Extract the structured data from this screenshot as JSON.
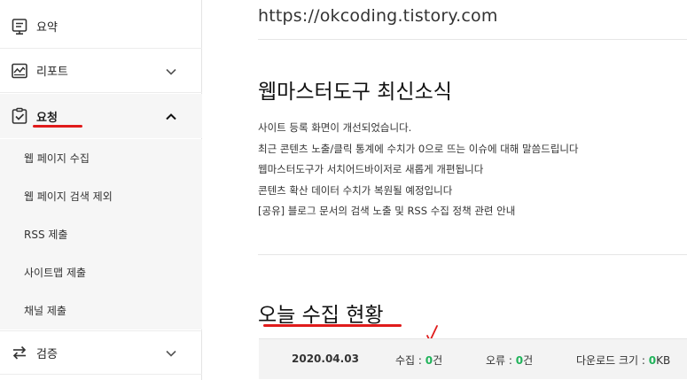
{
  "sidebar": {
    "items": [
      {
        "label": "요약",
        "icon": "summary-icon"
      },
      {
        "label": "리포트",
        "icon": "report-chart-icon"
      },
      {
        "label": "요청",
        "icon": "request-check-icon"
      },
      {
        "label": "검증",
        "icon": "verify-swap-icon"
      }
    ],
    "subitems": [
      {
        "label": "웹 페이지 수집"
      },
      {
        "label": "웹 페이지 검색 제외"
      },
      {
        "label": "RSS 제출"
      },
      {
        "label": "사이트맵 제출"
      },
      {
        "label": "채널 제출"
      }
    ]
  },
  "main": {
    "site_url": "https://okcoding.tistory.com",
    "news_title": "웹마스터도구 최신소식",
    "news": [
      "사이트 등록 화면이 개선되었습니다.",
      "최근 콘텐츠 노출/클릭 통계에 수치가 0으로 뜨는 이슈에 대해 말씀드립니다",
      "웹마스터도구가 서치어드바이저로 새롭게 개편됩니다",
      "콘텐츠 확산 데이터 수치가 복원될 예정입니다",
      "[공유] 블로그 문서의 검색 노출 및 RSS 수집 정책 관련 안내"
    ],
    "stats_title": "오늘 수집 현황",
    "stats": {
      "date": "2020.04.03",
      "collect_label": "수집 : ",
      "collect_value": "0",
      "collect_unit": "건",
      "error_label": "오류 : ",
      "error_value": "0",
      "error_unit": "건",
      "download_label": "다운로드 크기 : ",
      "download_value": "0",
      "download_unit": "KB"
    }
  },
  "colors": {
    "accent_green": "#20b35a",
    "annotation_red": "#e01b1b"
  }
}
